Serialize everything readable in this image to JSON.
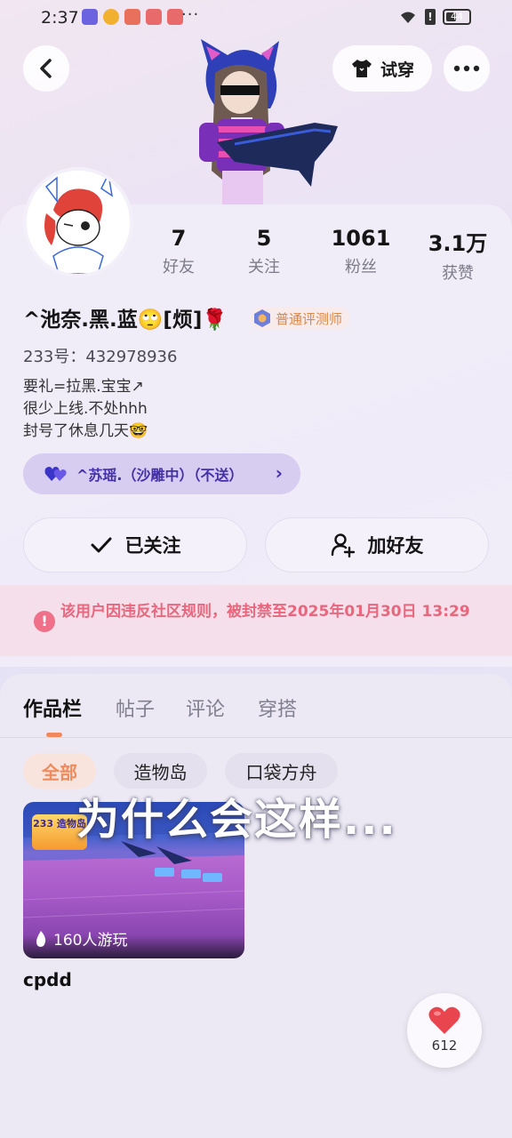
{
  "status_bar": {
    "time": "2:37",
    "dots": "···",
    "battery": "44",
    "battery_level": 0.44
  },
  "header": {
    "back_icon": "chevron-left-icon",
    "try_on_label": "试穿",
    "more_icon": "more-horizontal-icon"
  },
  "profile": {
    "stats": [
      {
        "value": "7",
        "label": "好友"
      },
      {
        "value": "5",
        "label": "关注"
      },
      {
        "value": "1061",
        "label": "粉丝"
      },
      {
        "value": "3.1万",
        "label": "获赞"
      }
    ],
    "nickname": "^池奈.黑.蓝🙄[烦]🌹",
    "role_badge": "普通评测师",
    "id_line": "233号：432978936",
    "bio": [
      "要礼=拉黑.宝宝↗",
      "很少上线.不处hhh",
      "封号了休息几天🤓"
    ],
    "couple_label": "^苏瑶.（沙雕中）（不送）",
    "couple_chevron": "›"
  },
  "actions": {
    "followed_label": "已关注",
    "add_friend_label": "加好友"
  },
  "ban_notice": {
    "icon": "alert-icon",
    "text": "该用户因违反社区规则，被封禁至2025年01月30日 13:29"
  },
  "tabs": [
    "作品栏",
    "帖子",
    "评论",
    "穿搭"
  ],
  "filters": [
    "全部",
    "造物岛",
    "口袋方舟"
  ],
  "work": {
    "badge": "233 造物岛",
    "plays": "160人游玩",
    "title": "cpdd"
  },
  "overlay_caption": "为什么会这样...",
  "like": {
    "count": "612"
  },
  "colors": {
    "accent_orange": "#f08a5d",
    "ban_red": "#e9667d",
    "couple_purple": "#4430a8"
  }
}
